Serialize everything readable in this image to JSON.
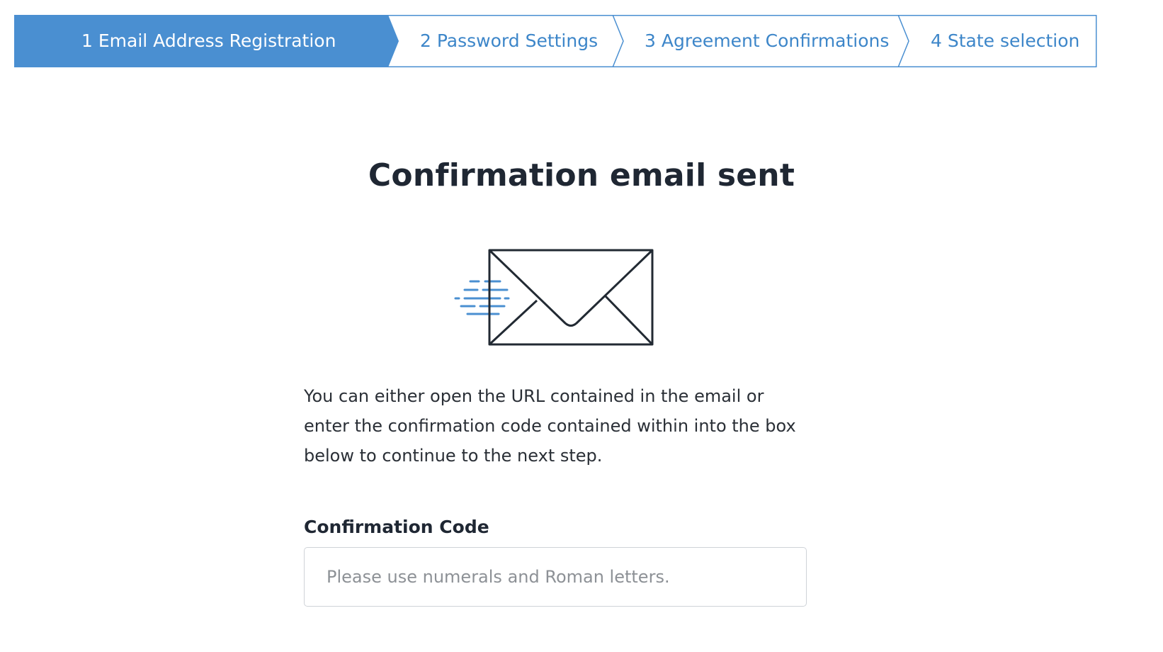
{
  "stepper": {
    "steps": [
      {
        "label": "1 Email Address Registration",
        "active": true
      },
      {
        "label": "2 Password Settings",
        "active": false
      },
      {
        "label": "3 Agreement Confirmations",
        "active": false
      },
      {
        "label": "4 State selection",
        "active": false
      }
    ],
    "accent_color": "#4a8fd1"
  },
  "main": {
    "title": "Confirmation email sent",
    "icon": "envelope-sent-icon",
    "message": "You can either open the URL contained in the email or enter the confirmation code contained within into the box below to continue to the next step.",
    "code_field": {
      "label": "Confirmation Code",
      "value": "",
      "placeholder": "Please use numerals and Roman letters."
    }
  }
}
